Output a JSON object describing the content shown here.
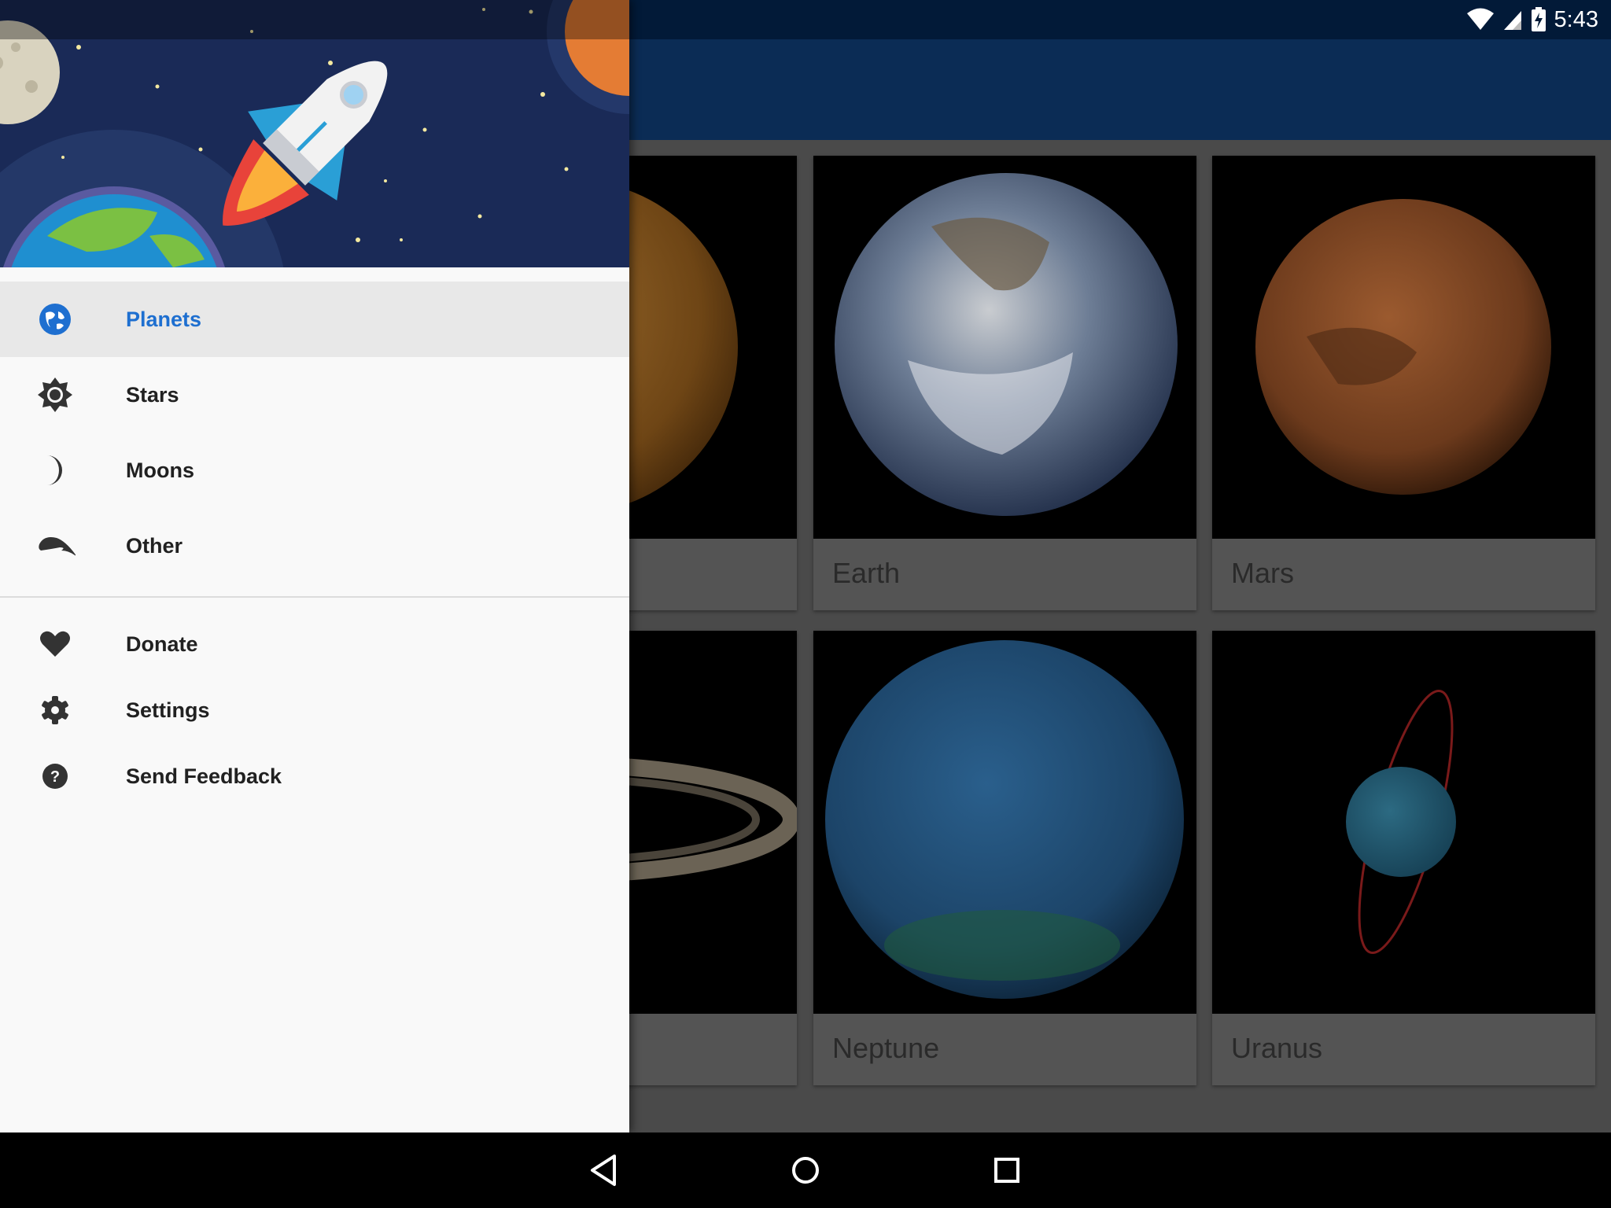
{
  "status_bar": {
    "time": "5:43"
  },
  "grid": {
    "cards": [
      {
        "name": "",
        "image": "venus"
      },
      {
        "name": "Earth",
        "image": "earth"
      },
      {
        "name": "Mars",
        "image": "mars"
      },
      {
        "name": "",
        "image": "saturn"
      },
      {
        "name": "Neptune",
        "image": "neptune"
      },
      {
        "name": "Uranus",
        "image": "uranus"
      }
    ]
  },
  "drawer": {
    "primary_items": [
      {
        "label": "Planets",
        "icon": "globe-icon",
        "active": true
      },
      {
        "label": "Stars",
        "icon": "sun-icon",
        "active": false
      },
      {
        "label": "Moons",
        "icon": "moon-icon",
        "active": false
      },
      {
        "label": "Other",
        "icon": "comet-icon",
        "active": false
      }
    ],
    "secondary_items": [
      {
        "label": "Donate",
        "icon": "heart-icon"
      },
      {
        "label": "Settings",
        "icon": "gear-icon"
      },
      {
        "label": "Send Feedback",
        "icon": "help-icon"
      }
    ]
  },
  "colors": {
    "accent": "#1e6fd0",
    "app_bar": "#0b2c55",
    "status_bar": "#021a38",
    "drawer_header": "#1a2a57"
  },
  "nav_bar": {
    "buttons": [
      "back-icon",
      "home-icon",
      "recents-icon"
    ]
  }
}
